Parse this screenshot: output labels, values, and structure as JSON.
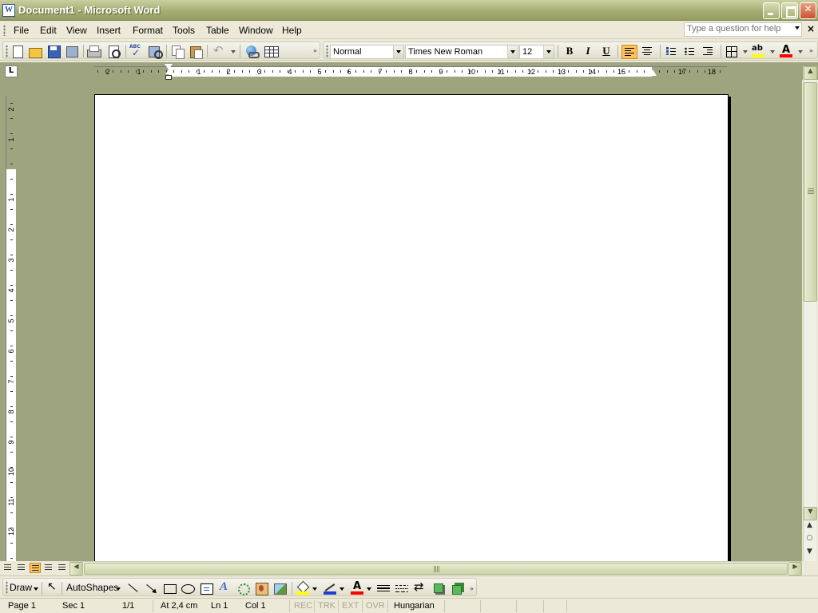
{
  "window": {
    "title": "Document1 - Microsoft Word",
    "app_icon_letter": "W"
  },
  "menu": {
    "items": [
      "File",
      "Edit",
      "View",
      "Insert",
      "Format",
      "Tools",
      "Table",
      "Window",
      "Help"
    ],
    "help_placeholder": "Type a question for help",
    "close_glyph": "×"
  },
  "toolbar": {
    "style": "Normal",
    "font": "Times New Roman",
    "size": "12",
    "bold": "B",
    "italic": "I",
    "underline": "U"
  },
  "ruler": {
    "tab_selector": "L",
    "h_numbers": [
      "2",
      "1",
      "1",
      "2",
      "3",
      "4",
      "5",
      "6",
      "7",
      "8",
      "9",
      "10",
      "11",
      "12",
      "13",
      "14",
      "15",
      "17",
      "18"
    ],
    "v_numbers": [
      "2",
      "1",
      "1",
      "2",
      "3",
      "4",
      "5",
      "6",
      "7",
      "8",
      "9",
      "10",
      "11",
      "12"
    ]
  },
  "drawing": {
    "draw_label": "Draw",
    "autoshapes_label": "AutoShapes"
  },
  "status": {
    "page": "Page  1",
    "section": "Sec  1",
    "page_count": "1/1",
    "at": "At  2,4 cm",
    "line": "Ln  1",
    "col": "Col  1",
    "rec": "REC",
    "trk": "TRK",
    "ext": "EXT",
    "ovr": "OVR",
    "language": "Hungarian"
  },
  "colors": {
    "highlight": "#FFFF00",
    "font_color": "#FF0000",
    "line_color": "#1E3FD0",
    "workspace": "#9EA57E"
  }
}
